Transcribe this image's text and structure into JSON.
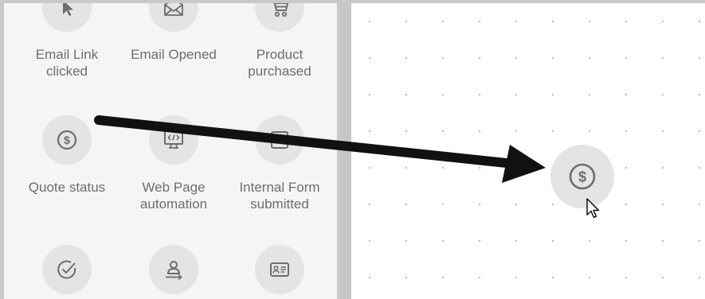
{
  "palette": {
    "items": [
      {
        "label": "Email Link clicked",
        "icon": "cursor-arrow-icon"
      },
      {
        "label": "Email Opened",
        "icon": "open-envelope-icon"
      },
      {
        "label": "Product purchased",
        "icon": "shopping-cart-icon"
      },
      {
        "label": "Quote status",
        "icon": "dollar-coin-icon"
      },
      {
        "label": "Web Page automation",
        "icon": "web-code-monitor-icon"
      },
      {
        "label": "Internal Form submitted",
        "icon": "form-document-icon"
      },
      {
        "label": "",
        "icon": "check-circle-icon"
      },
      {
        "label": "",
        "icon": "person-arrow-icon"
      },
      {
        "label": "",
        "icon": "contact-card-icon"
      }
    ]
  },
  "canvas": {
    "dropped_node": {
      "icon": "dollar-coin-icon"
    }
  },
  "annotation": {
    "icon": "drag-arrow-icon"
  },
  "colors": {
    "panel_bg": "#f5f5f5",
    "icon_circle": "#e4e4e4",
    "icon_stroke": "#6d6d6d",
    "divider": "#c7c7c7",
    "arrow": "#111111"
  }
}
